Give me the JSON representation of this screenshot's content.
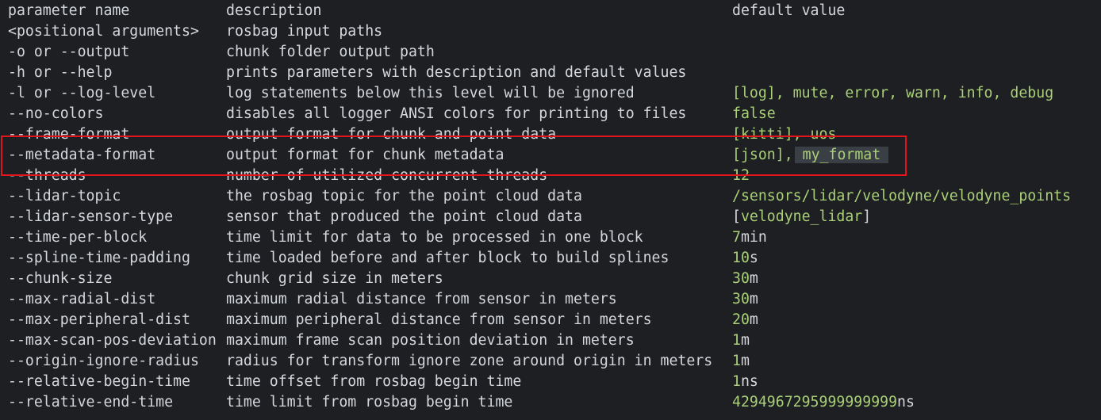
{
  "header": {
    "name": "parameter name",
    "desc": "description",
    "def": "default value"
  },
  "rows": [
    {
      "name": "<positional arguments>",
      "desc": "rosbag input paths",
      "def_plain": "",
      "def_highlight": "",
      "def_unit": ""
    },
    {
      "name": "-o or --output",
      "desc": "chunk folder output path",
      "def_plain": "",
      "def_highlight": "",
      "def_unit": ""
    },
    {
      "name": "-h or --help",
      "desc": "prints parameters with description and default values",
      "def_plain": "",
      "def_highlight": "",
      "def_unit": ""
    },
    {
      "name": "-l or --log-level",
      "desc": "log statements below this level will be ignored",
      "def_plain": "",
      "def_highlight": "[log], mute, error, warn, info, debug",
      "def_unit": ""
    },
    {
      "name": "--no-colors",
      "desc": "disables all logger ANSI colors for printing to files",
      "def_plain": "",
      "def_highlight": "false",
      "def_unit": ""
    },
    {
      "name": "--frame-format",
      "desc": "output format for chunk and point data",
      "def_plain": "",
      "def_highlight": "[kitti], uos",
      "def_unit": ""
    },
    {
      "name": "--metadata-format",
      "desc": "output format for chunk metadata",
      "def_plain": "",
      "def_highlight": "[json],",
      "def_unit": "",
      "def_chip": "my_format"
    },
    {
      "name": "--threads",
      "desc": "number of utilized concurrent threads",
      "def_plain": "",
      "def_highlight": "12",
      "def_unit": ""
    },
    {
      "name": "--lidar-topic",
      "desc": "the rosbag topic for the point cloud data",
      "def_plain": "",
      "def_highlight": "/sensors/lidar/velodyne/velodyne_points",
      "def_unit": ""
    },
    {
      "name": "--lidar-sensor-type",
      "desc": "sensor that produced the point cloud data",
      "def_plain": "[",
      "def_highlight": "velodyne_lidar",
      "def_unit": "]"
    },
    {
      "name": "--time-per-block",
      "desc": "time limit for data to be processed in one block",
      "def_plain": "",
      "def_highlight": "7",
      "def_unit": "min"
    },
    {
      "name": "--spline-time-padding",
      "desc": "time loaded before and after block to build splines",
      "def_plain": "",
      "def_highlight": "10",
      "def_unit": "s"
    },
    {
      "name": "--chunk-size",
      "desc": "chunk grid size in meters",
      "def_plain": "",
      "def_highlight": "30",
      "def_unit": "m"
    },
    {
      "name": "--max-radial-dist",
      "desc": "maximum radial distance from sensor in meters",
      "def_plain": "",
      "def_highlight": "30",
      "def_unit": "m"
    },
    {
      "name": "--max-peripheral-dist",
      "desc": "maximum peripheral distance from sensor in meters",
      "def_plain": "",
      "def_highlight": "20",
      "def_unit": "m"
    },
    {
      "name": "--max-scan-pos-deviation",
      "desc": "maximum frame scan position deviation in meters",
      "def_plain": "",
      "def_highlight": "1",
      "def_unit": "m"
    },
    {
      "name": "--origin-ignore-radius",
      "desc": "radius for transform ignore zone around origin in meters",
      "def_plain": "",
      "def_highlight": "1",
      "def_unit": "m"
    },
    {
      "name": "--relative-begin-time",
      "desc": "time offset from rosbag begin time",
      "def_plain": "",
      "def_highlight": "1",
      "def_unit": "ns"
    },
    {
      "name": "--relative-end-time",
      "desc": "time limit from rosbag begin time",
      "def_plain": "",
      "def_highlight": "4294967295999999999",
      "def_unit": "ns"
    }
  ],
  "colors": {
    "background": "#1e1f22",
    "text": "#d4d7dc",
    "value": "#a9cf78",
    "annotation": "#e3141b",
    "chip": "#3a3f45"
  }
}
